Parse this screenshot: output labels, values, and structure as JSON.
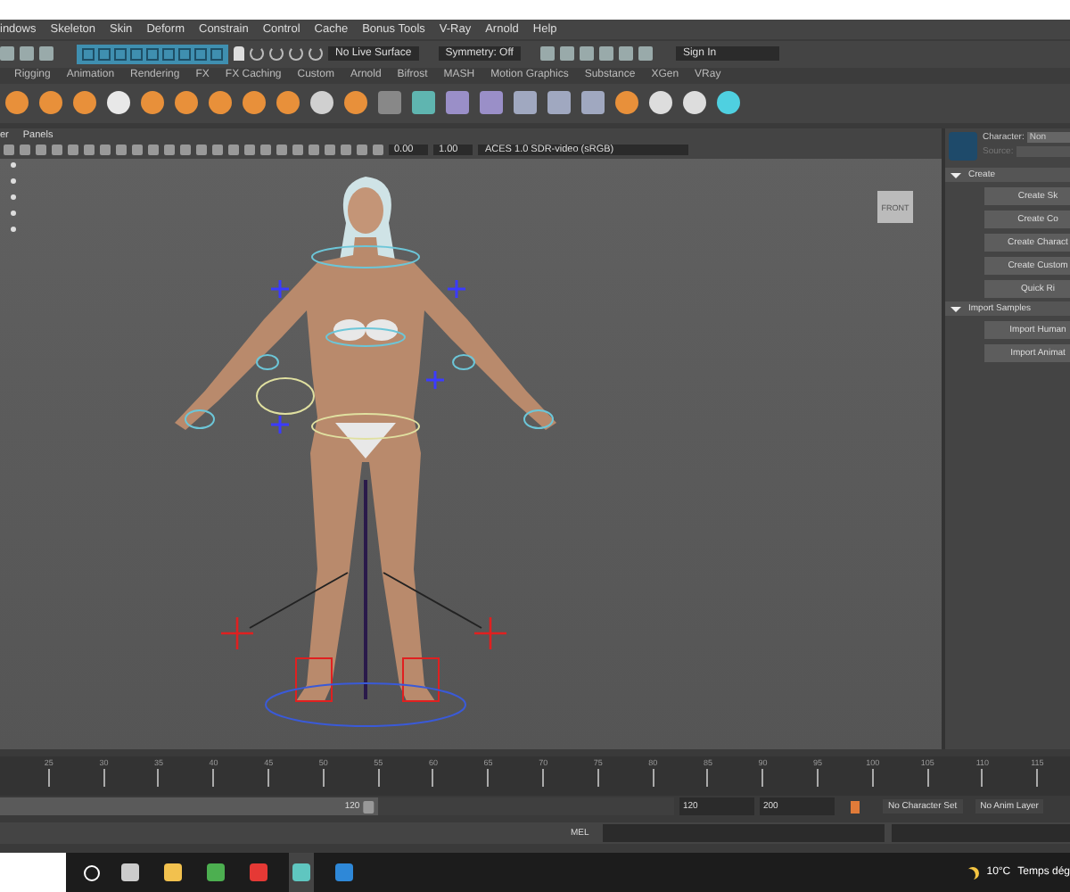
{
  "menu_bar": {
    "items": [
      "indows",
      "Skeleton",
      "Skin",
      "Deform",
      "Constrain",
      "Control",
      "Cache",
      "Bonus Tools",
      "V-Ray",
      "Arnold",
      "Help"
    ]
  },
  "status_line": {
    "live_surface": "No Live Surface",
    "symmetry": "Symmetry: Off",
    "sign_in": "Sign In"
  },
  "shelf": {
    "tabs": [
      "Rigging",
      "Animation",
      "Rendering",
      "FX",
      "FX Caching",
      "Custom",
      "Arnold",
      "Bifrost",
      "MASH",
      "Motion Graphics",
      "Substance",
      "XGen",
      "VRay"
    ]
  },
  "viewport": {
    "menus": [
      "er",
      "Panels"
    ],
    "exposure": "0.00",
    "gamma": "1.00",
    "color_space": "ACES 1.0 SDR-video (sRGB)",
    "view_cube": "FRONT"
  },
  "character_panel": {
    "character_label": "Character:",
    "character_value": "Non",
    "source_label": "Source:",
    "sections": [
      {
        "title": "Create",
        "expanded": true,
        "buttons": [
          "Create Sk",
          "Create Co",
          "Create Charact",
          "Create Custom",
          "Quick Ri"
        ]
      },
      {
        "title": "Import Samples",
        "expanded": true,
        "buttons": [
          "Import Human",
          "Import Animat"
        ]
      }
    ]
  },
  "time_slider": {
    "ticks": [
      "25",
      "30",
      "35",
      "40",
      "45",
      "50",
      "55",
      "60",
      "65",
      "70",
      "75",
      "80",
      "85",
      "90",
      "95",
      "100",
      "105",
      "110",
      "115"
    ]
  },
  "range_slider": {
    "level": 0.56,
    "handle_value": "120",
    "end_time": "120",
    "max_time": "200",
    "character_set": "No Character Set",
    "anim_layer": "No Anim Layer"
  },
  "command_line": {
    "language": "MEL"
  },
  "taskbar": {
    "temperature": "10°C",
    "weather": "Temps dég"
  }
}
